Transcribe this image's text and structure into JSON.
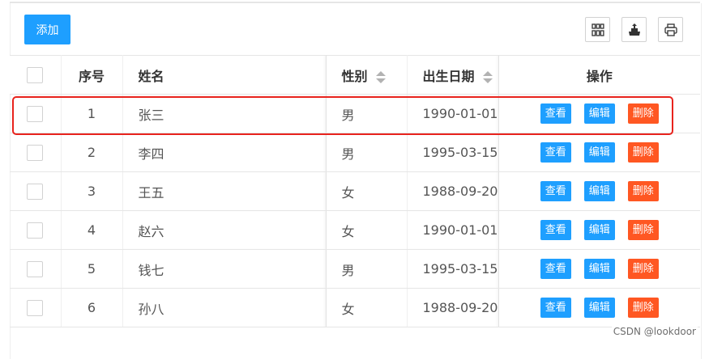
{
  "toolbar": {
    "add_label": "添加",
    "tools": [
      {
        "icon": "columns-grid-icon"
      },
      {
        "icon": "export-icon"
      },
      {
        "icon": "print-icon"
      }
    ]
  },
  "table": {
    "headers": {
      "index": "序号",
      "name": "姓名",
      "gender": "性别",
      "birth": "出生日期",
      "actions": "操作"
    },
    "rows": [
      {
        "index": "1",
        "name": "张三",
        "gender": "男",
        "birth": "1990-01-01"
      },
      {
        "index": "2",
        "name": "李四",
        "gender": "男",
        "birth": "1995-03-15"
      },
      {
        "index": "3",
        "name": "王五",
        "gender": "女",
        "birth": "1988-09-20"
      },
      {
        "index": "4",
        "name": "赵六",
        "gender": "女",
        "birth": "1990-01-01"
      },
      {
        "index": "5",
        "name": "钱七",
        "gender": "男",
        "birth": "1995-03-15"
      },
      {
        "index": "6",
        "name": "孙八",
        "gender": "女",
        "birth": "1988-09-20"
      }
    ],
    "actions": {
      "view": "查看",
      "edit": "编辑",
      "delete": "删除"
    },
    "highlighted_row": 1
  },
  "colors": {
    "primary": "#1e9fff",
    "danger": "#ff5722",
    "highlight": "#e8231d"
  },
  "watermark": "CSDN @lookdoor"
}
